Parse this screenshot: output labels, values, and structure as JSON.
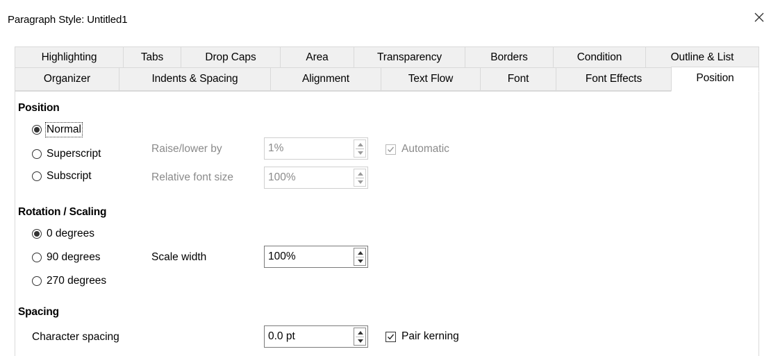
{
  "window": {
    "title": "Paragraph Style: Untitled1"
  },
  "tabs_row1": [
    "Highlighting",
    "Tabs",
    "Drop Caps",
    "Area",
    "Transparency",
    "Borders",
    "Condition",
    "Outline & List"
  ],
  "tabs_row2": [
    "Organizer",
    "Indents & Spacing",
    "Alignment",
    "Text Flow",
    "Font",
    "Font Effects",
    "Position"
  ],
  "active_tab": "Position",
  "position": {
    "heading": "Position",
    "normal": "Normal",
    "superscript": "Superscript",
    "subscript": "Subscript",
    "selected": "Normal",
    "raise_label": "Raise/lower by",
    "raise_value": "1%",
    "relsize_label": "Relative font size",
    "relsize_value": "100%",
    "automatic_label": "Automatic",
    "automatic_checked": true
  },
  "rotation": {
    "heading": "Rotation / Scaling",
    "deg0": "0 degrees",
    "deg90": "90 degrees",
    "deg270": "270 degrees",
    "selected": "0 degrees",
    "scale_label": "Scale width",
    "scale_value": "100%"
  },
  "spacing": {
    "heading": "Spacing",
    "char_label": "Character spacing",
    "char_value": "0.0 pt",
    "pair_kerning_label": "Pair kerning",
    "pair_kerning_checked": true
  },
  "icons": {
    "close": "close-icon",
    "radio": "radio-icon",
    "checkbox": "checkbox-icon",
    "spin": "spin-arrows-icon"
  }
}
